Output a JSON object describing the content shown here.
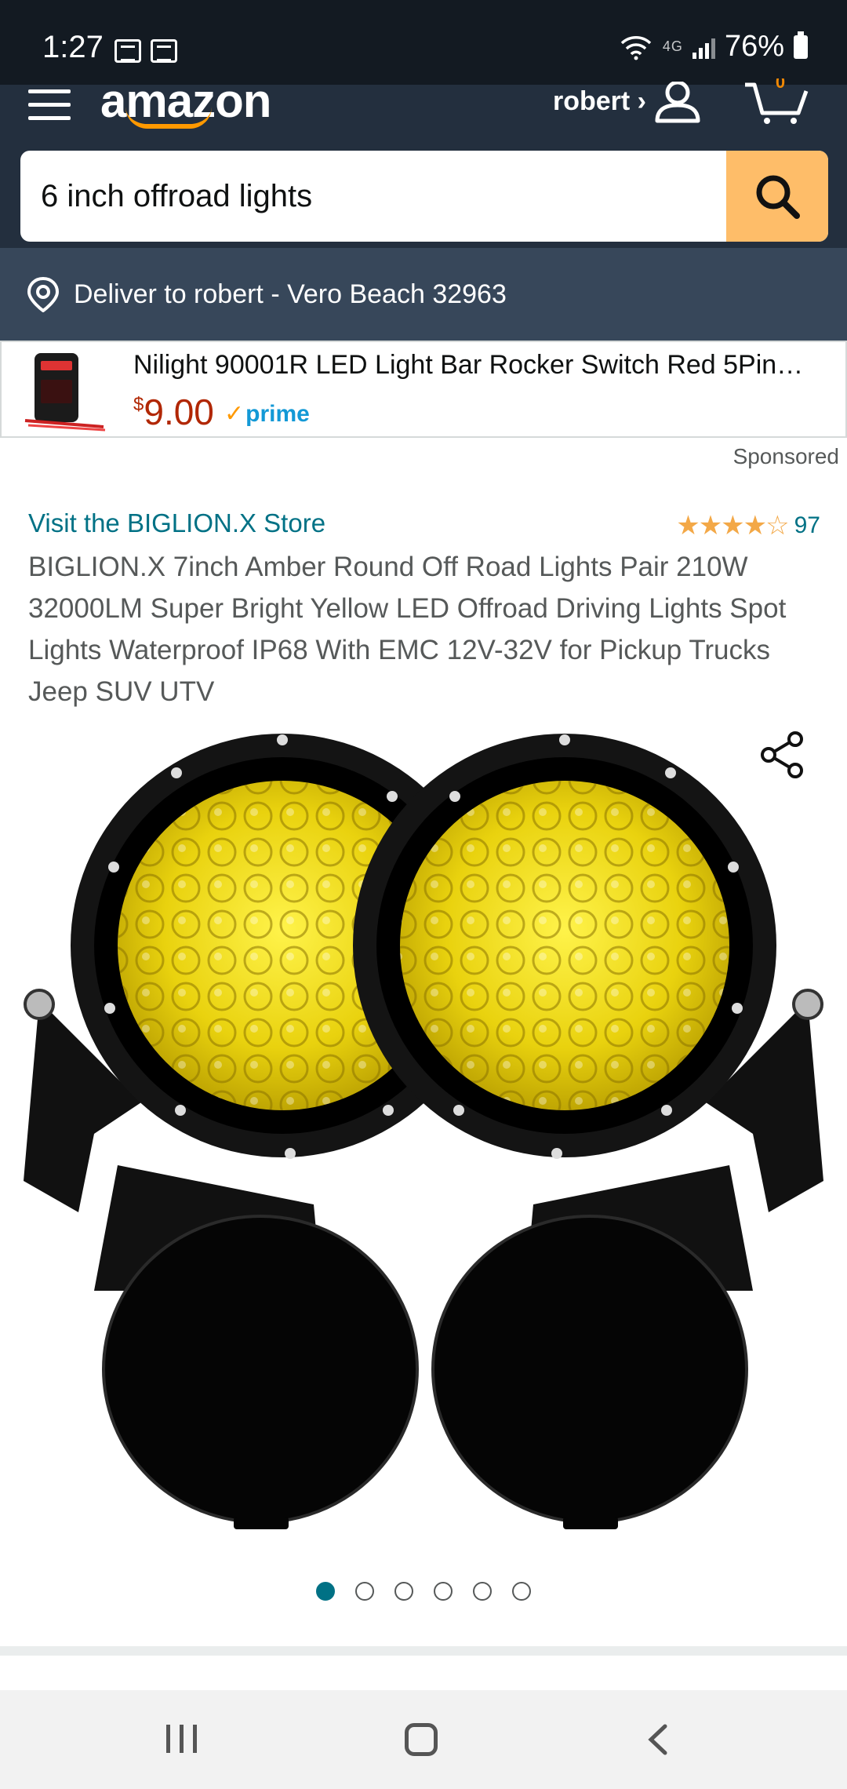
{
  "status_bar": {
    "time": "1:27",
    "network": "4G",
    "battery": "76%"
  },
  "header": {
    "logo": "amazon",
    "account_label": "robert ›",
    "cart_count": "0",
    "search_value": "6 inch offroad lights"
  },
  "deliver": {
    "text": "Deliver to robert - Vero Beach 32963"
  },
  "sponsored_ad": {
    "title": "Nilight 90001R LED Light Bar Rocker Switch Red 5Pin…",
    "price_currency": "$",
    "price_amount": "9.00",
    "prime_label": "prime",
    "sponsored_label": "Sponsored"
  },
  "product": {
    "store_link": "Visit the BIGLION.X Store",
    "rating_stars": "★★★★☆",
    "rating_value": 4.5,
    "rating_count": "97",
    "title": "BIGLION.X 7inch Amber Round Off Road Lights Pair 210W 32000LM Super Bright Yellow LED Offroad Driving Lights Spot Lights Waterproof IP68 With EMC 12V-32V for Pickup Trucks Jeep SUV UTV"
  },
  "gallery": {
    "total_images": 6,
    "active_index": 0
  },
  "colors": {
    "header": "#232F3E",
    "deliver_bar": "#37475A",
    "search_button": "#FEBD69",
    "link": "#007185",
    "price": "#B12704",
    "prime": "#1399D6",
    "stars": "#F3A847"
  }
}
